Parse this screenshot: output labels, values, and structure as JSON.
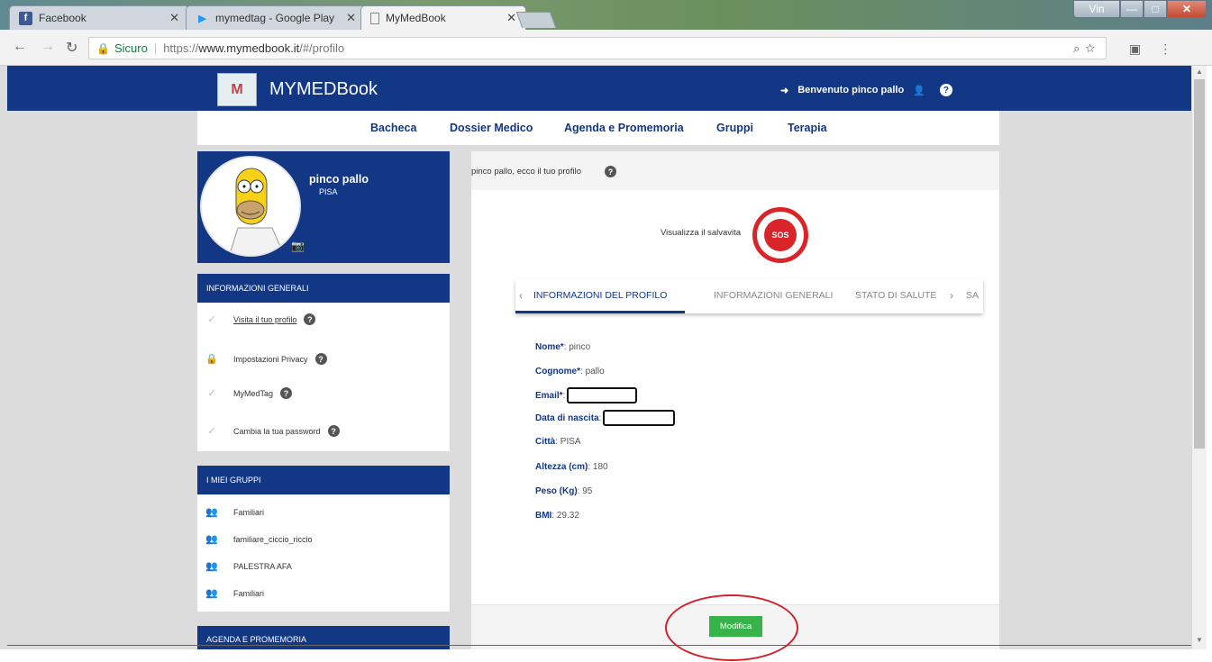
{
  "browser": {
    "tabs": [
      {
        "title": "Facebook",
        "icon": "facebook-icon"
      },
      {
        "title": "mymedtag - Google Play",
        "icon": "google-play-icon"
      },
      {
        "title": "MyMedBook",
        "icon": "page-icon"
      }
    ],
    "user_badge": "Vin",
    "secure_label": "Sicuro",
    "url_prefix": "https://",
    "url_host": "www.mymedbook.it",
    "url_path": "/#/profilo"
  },
  "header": {
    "brand": "MYMEDBook",
    "welcome": "Benvenuto pinco pallo",
    "help": "?"
  },
  "menu": {
    "items": [
      "Bacheca",
      "Dossier Medico",
      "Agenda e Promemoria",
      "Gruppi",
      "Terapia"
    ]
  },
  "profile": {
    "name": "pinco pallo",
    "city": "PISA"
  },
  "sidebar": {
    "general_title": "INFORMAZIONI GENERALI",
    "general_items": [
      {
        "label": "Visita il tuo profilo",
        "icon": "check-icon"
      },
      {
        "label": "Impostazioni Privacy",
        "icon": "lock-icon"
      },
      {
        "label": "MyMedTag",
        "icon": "check-icon"
      },
      {
        "label": "Cambia la tua password",
        "icon": "check-icon"
      }
    ],
    "groups_title": "I MIEI GRUPPI",
    "groups": [
      "Familiari",
      "familiare_ciccio_riccio",
      "PALESTRA AFA",
      "Familiari"
    ],
    "agenda_title": "AGENDA E PROMEMORIA"
  },
  "main": {
    "header_text": "pinco pallo, ecco il tuo profilo",
    "salvavita": "Visualizza il salvavita",
    "sos_label": "SOS",
    "tabs": [
      "INFORMAZIONI DEL PROFILO",
      "INFORMAZIONI GENERALI",
      "STATO DI SALUTE",
      "SA"
    ],
    "fields": [
      {
        "label": "Nome*",
        "value": "pinco"
      },
      {
        "label": "Cognome*",
        "value": "pallo"
      },
      {
        "label": "Email*",
        "value": ""
      },
      {
        "label": "Data di nascita",
        "value": ""
      },
      {
        "label": "Città",
        "value": "PISA"
      },
      {
        "label": "Altezza (cm)",
        "value": "180"
      },
      {
        "label": "Peso (Kg)",
        "value": "95"
      },
      {
        "label": "BMI",
        "value": "29.32"
      }
    ],
    "edit_button": "Modifica"
  },
  "colors": {
    "brand_blue": "#123785",
    "button_green": "#38b34a",
    "annotation_red": "#d0202a"
  }
}
